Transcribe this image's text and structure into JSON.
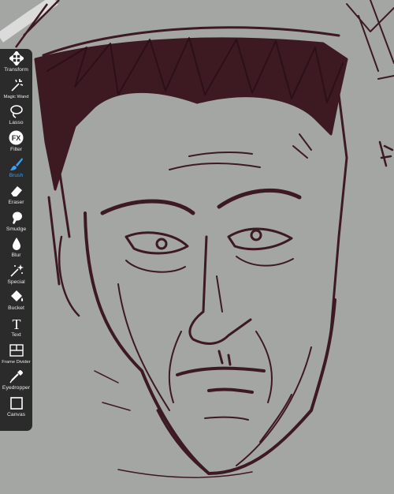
{
  "app": {
    "accent": "#3aa0ef",
    "ink_color": "#3d1a22",
    "canvas_bg": "#a3a6a3",
    "toolbar_bg": "#2b2b2b"
  },
  "toolbar": {
    "active_tool": "Brush",
    "tools": [
      {
        "label": "Transform",
        "icon": "transform-icon"
      },
      {
        "label": "Magic Wand",
        "icon": "magic-wand-icon"
      },
      {
        "label": "Lasso",
        "icon": "lasso-icon"
      },
      {
        "label": "Filter",
        "icon": "fx-icon",
        "icon_text": "FX"
      },
      {
        "label": "Brush",
        "icon": "brush-icon"
      },
      {
        "label": "Eraser",
        "icon": "eraser-icon"
      },
      {
        "label": "Smudge",
        "icon": "smudge-icon"
      },
      {
        "label": "Blur",
        "icon": "blur-drop-icon"
      },
      {
        "label": "Special",
        "icon": "special-wand-icon"
      },
      {
        "label": "Bucket",
        "icon": "bucket-icon"
      },
      {
        "label": "Text",
        "icon": "text-icon",
        "icon_text": "T"
      },
      {
        "label": "Frame Divider",
        "icon": "frame-divider-icon"
      },
      {
        "label": "Eyedropper",
        "icon": "eyedropper-icon"
      },
      {
        "label": "Canvas",
        "icon": "canvas-icon"
      }
    ]
  }
}
